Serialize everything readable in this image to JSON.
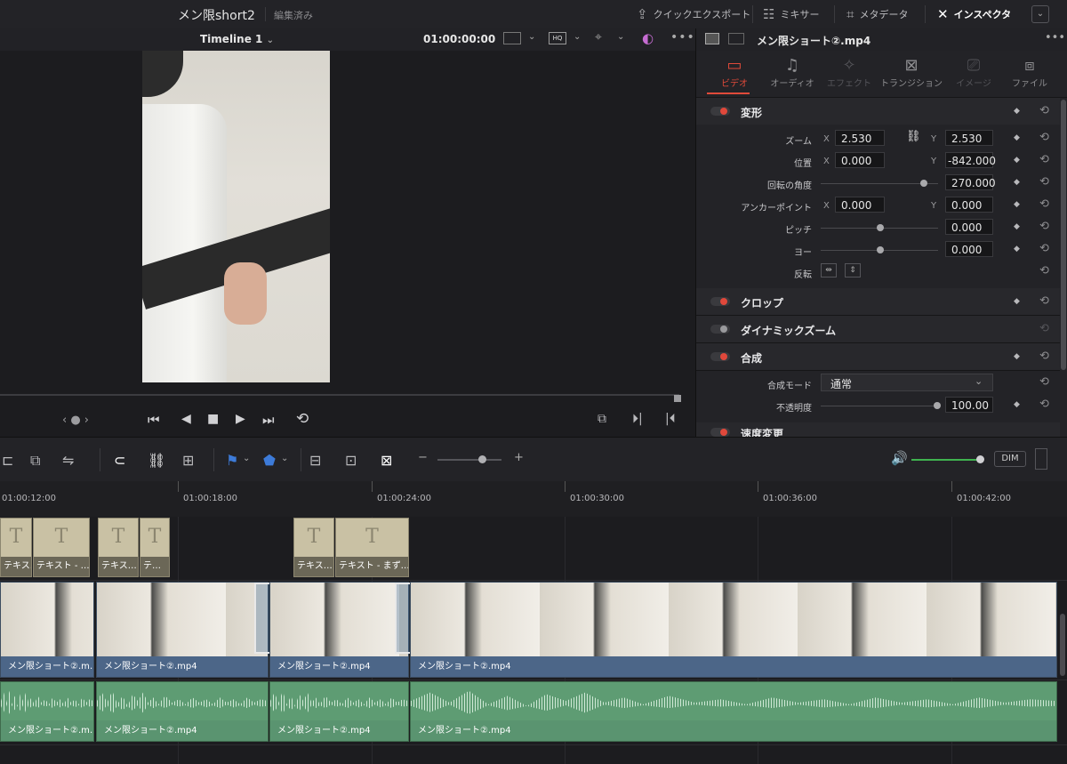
{
  "topbar": {
    "project_name": "メン限short2",
    "project_status": "編集済み",
    "quick_export": "クイックエクスポート",
    "mixer": "ミキサー",
    "metadata": "メタデータ",
    "inspector": "インスペクタ"
  },
  "viewer": {
    "timeline_name": "Timeline 1",
    "timecode": "01:00:00:00"
  },
  "inspector": {
    "clip_name": "メン限ショート②.mp4",
    "tabs": [
      {
        "label": "ビデオ",
        "state": "active"
      },
      {
        "label": "オーディオ",
        "state": "normal"
      },
      {
        "label": "エフェクト",
        "state": "disabled"
      },
      {
        "label": "トランジション",
        "state": "normal"
      },
      {
        "label": "イメージ",
        "state": "disabled"
      },
      {
        "label": "ファイル",
        "state": "normal"
      }
    ],
    "transform": {
      "title": "変形",
      "zoom_label": "ズーム",
      "zoom_x": "2.530",
      "zoom_y": "2.530",
      "position_label": "位置",
      "position_x": "0.000",
      "position_y": "-842.000",
      "rotation_label": "回転の角度",
      "rotation": "270.000",
      "anchor_label": "アンカーポイント",
      "anchor_x": "0.000",
      "anchor_y": "0.000",
      "pitch_label": "ピッチ",
      "pitch": "0.000",
      "yaw_label": "ヨー",
      "yaw": "0.000",
      "flip_label": "反転",
      "x": "X",
      "y": "Y"
    },
    "crop_title": "クロップ",
    "dynamic_zoom_title": "ダイナミックズーム",
    "composite": {
      "title": "合成",
      "mode_label": "合成モード",
      "mode_value": "通常",
      "opacity_label": "不透明度",
      "opacity": "100.00"
    },
    "speed_title": "速度変更"
  },
  "timeline": {
    "dim_label": "DIM",
    "ruler": [
      "01:00:12:00",
      "01:00:18:00",
      "01:00:24:00",
      "01:00:30:00",
      "01:00:36:00",
      "01:00:42:00"
    ],
    "text_clips": [
      "テキス…",
      "テキスト - …",
      "テキス…",
      "テ…",
      "テキス…",
      "テキスト - まず…"
    ],
    "video_clips": [
      "メン限ショート②.m…",
      "メン限ショート②.mp4",
      "メン限ショート②.mp4",
      "メン限ショート②.mp4"
    ],
    "audio_clips": [
      "メン限ショート②.m…",
      "メン限ショート②.mp4",
      "メン限ショート②.mp4",
      "メン限ショート②.mp4"
    ]
  }
}
